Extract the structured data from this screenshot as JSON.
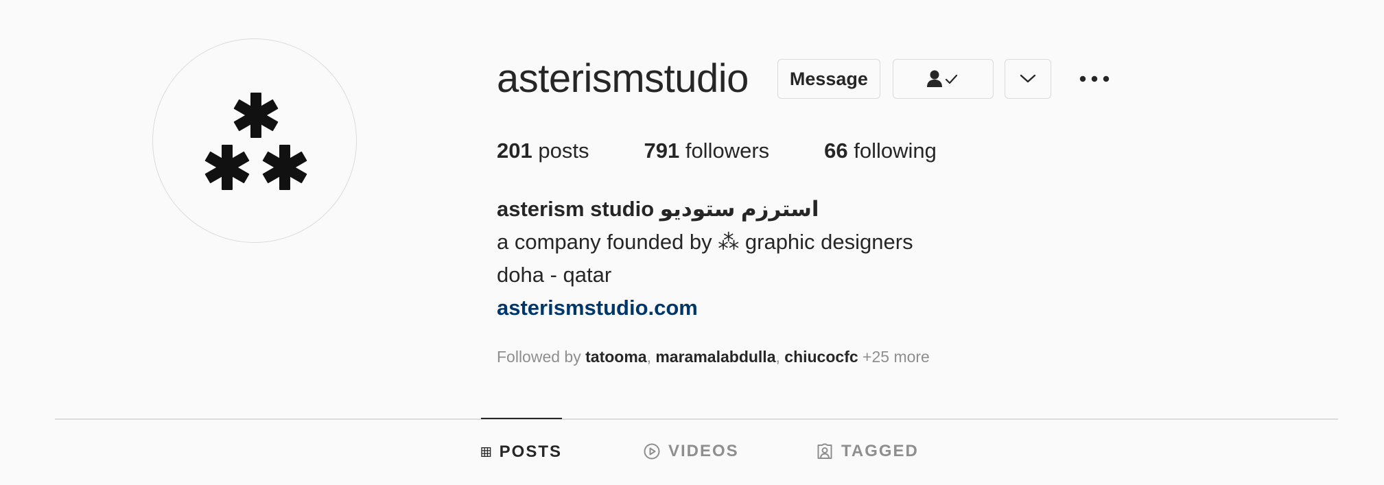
{
  "profile": {
    "username": "asterismstudio",
    "message_label": "Message",
    "stats": {
      "posts_count": "201",
      "posts_label": "posts",
      "followers_count": "791",
      "followers_label": "followers",
      "following_count": "66",
      "following_label": "following"
    },
    "bio": {
      "name": "asterism studio استرزم ستوديو",
      "line1": "a company founded by ⁂ graphic designers",
      "line2": "doha - qatar",
      "link": "asterismstudio.com"
    },
    "followed_by": {
      "prefix": "Followed by",
      "users": [
        "tatooma",
        "maramalabdulla",
        "chiucocfc"
      ],
      "more": "+25 more"
    }
  },
  "tabs": [
    {
      "label": "POSTS",
      "icon": "grid-icon",
      "active": true
    },
    {
      "label": "VIDEOS",
      "icon": "play-circle-icon",
      "active": false
    },
    {
      "label": "TAGGED",
      "icon": "tagged-user-icon",
      "active": false
    }
  ],
  "colors": {
    "background": "#fafafa",
    "text": "#262626",
    "muted": "#8e8e8e",
    "link": "#00376b",
    "border": "#dbdbdb"
  }
}
